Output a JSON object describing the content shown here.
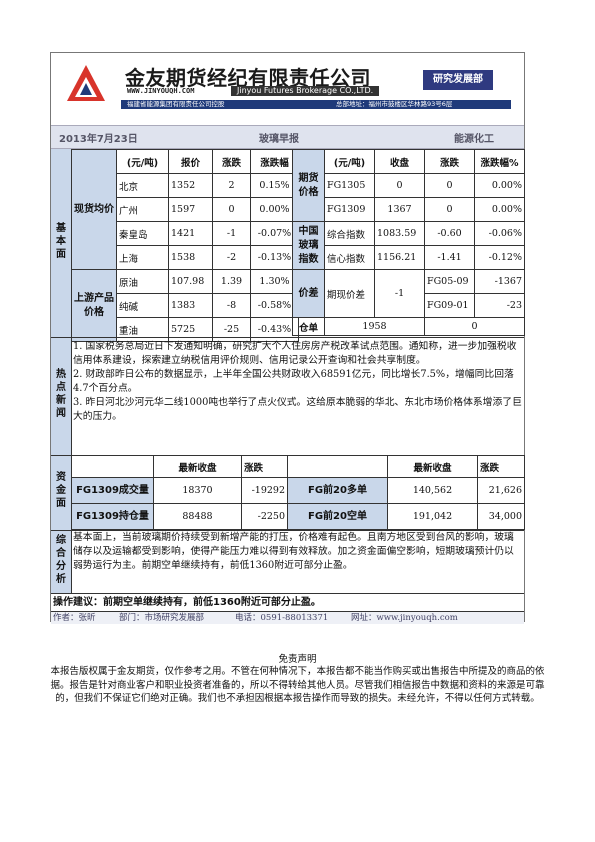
{
  "header": {
    "company_name": "金友期货经纪有限责任公司",
    "website": "WWW.JINYOUQH.COM",
    "english_name": "Jinyou Futures Brokerage CO.,LTD.",
    "department": "研究发展部",
    "holding": "福建省能源集团有限责任公司控股",
    "address": "总部地址：福州市鼓楼区华林路93号6层"
  },
  "report": {
    "date": "2013年7月23日",
    "title": "玻璃早报",
    "category": "能源化工"
  },
  "fundamentals": {
    "section_label": "基本面",
    "spot_label": "现货均价",
    "spot_headers": [
      "(元/吨)",
      "报价",
      "涨跌",
      "涨跌幅"
    ],
    "spot_rows": [
      {
        "city": "北京",
        "price": "1352",
        "change": "2",
        "pct": "0.15%"
      },
      {
        "city": "广州",
        "price": "1597",
        "change": "0",
        "pct": "0.00%"
      },
      {
        "city": "秦皇岛",
        "price": "1421",
        "change": "-1",
        "pct": "-0.07%"
      },
      {
        "city": "上海",
        "price": "1538",
        "change": "-2",
        "pct": "-0.13%"
      }
    ],
    "futures_label": "期货价格",
    "futures_headers": [
      "(元/吨)",
      "收盘",
      "涨跌",
      "涨跌幅%"
    ],
    "futures_rows": [
      {
        "contract": "FG1305",
        "close": "0",
        "change": "0",
        "pct": "0.00%"
      },
      {
        "contract": "FG1309",
        "close": "1367",
        "change": "0",
        "pct": "0.00%"
      }
    ],
    "index_label": "中国玻璃指数",
    "index_rows": [
      {
        "name": "综合指数",
        "value": "1083.59",
        "change": "-0.60",
        "pct": "-0.06%"
      },
      {
        "name": "信心指数",
        "value": "1156.21",
        "change": "-1.41",
        "pct": "-0.12%"
      }
    ],
    "upstream_label": "上游产品价格",
    "upstream_rows": [
      {
        "name": "原油",
        "price": "107.98",
        "change": "1.39",
        "pct": "1.30%"
      },
      {
        "name": "纯碱",
        "price": "1383",
        "change": "-8",
        "pct": "-0.58%"
      },
      {
        "name": "重油",
        "price": "5725",
        "change": "-25",
        "pct": "-0.43%"
      }
    ],
    "spread_label": "价差",
    "spread_name": "期现价差",
    "spread_value": "-1",
    "spread_rows": [
      {
        "contract": "FG05-09",
        "value": "-1367"
      },
      {
        "contract": "FG09-01",
        "value": "-23"
      }
    ],
    "warehouse_label": "仓单",
    "warehouse_value": "1958",
    "warehouse_change": "0"
  },
  "news": {
    "section_label": "热点新闻",
    "items": [
      "1. 国家税务总局近日下发通知明确，研究扩大个人住房房产税改革试点范围。通知称，进一步加强税收信用体系建设，探索建立纳税信用评价规则、信用记录公开查询和社会共享制度。",
      "2. 财政部昨日公布的数据显示，上半年全国公共财政收入68591亿元，同比增长7.5%，增幅同比回落4.7个百分点。",
      "3. 昨日河北沙河元华二线1000吨也举行了点火仪式。这给原本脆弱的华北、东北市场价格体系增添了巨大的压力。"
    ]
  },
  "funds": {
    "section_label": "资金面",
    "headers": [
      "最新收盘",
      "涨跌",
      "最新收盘",
      "涨跌"
    ],
    "rows": [
      {
        "left_name": "FG1309成交量",
        "left_value": "18370",
        "left_change": "-19292",
        "right_name": "FG前20多单",
        "right_value": "140,562",
        "right_change": "21,626"
      },
      {
        "left_name": "FG1309持仓量",
        "left_value": "88488",
        "left_change": "-2250",
        "right_name": "FG前20空单",
        "right_value": "191,042",
        "right_change": "34,000"
      }
    ]
  },
  "analysis": {
    "section_label": "综合分析",
    "text": "基本面上，当前玻璃期价持续受到新增产能的打压，价格难有起色。且南方地区受到台风的影响，玻璃储存以及运输都受到影响，使得产能压力难以得到有效释放。加之资金面偏空影响，短期玻璃预计仍以弱势运行为主。前期空单继续持有，前低1360附近可部分止盈。"
  },
  "advice": {
    "text": "操作建议：前期空单继续持有，前低1360附近可部分止盈。"
  },
  "footer": {
    "author": "作者：张昕",
    "dept": "部门：市场研究发展部",
    "phone": "电话：0591-88013371",
    "site": "网址：www.jinyouqh.com"
  },
  "disclaimer": {
    "title": "免责声明",
    "text": "本报告版权属于金友期货，仅作参考之用。不管在何种情况下，本报告都不能当作购买或出售报告中所提及的商品的依据。报告是针对商业客户和职业投资者准备的，所以不得转给其他人员。尽管我们相信报告中数据和资料的来源是可靠的，但我们不保证它们绝对正确。我们也不承担因根据本报告操作而导致的损失。未经允许，不得以任何方式转载。"
  },
  "colors": {
    "section_bg": "#c9d7ea",
    "brand_blue": "#2f3a80",
    "logo_red": "#d8342b"
  }
}
